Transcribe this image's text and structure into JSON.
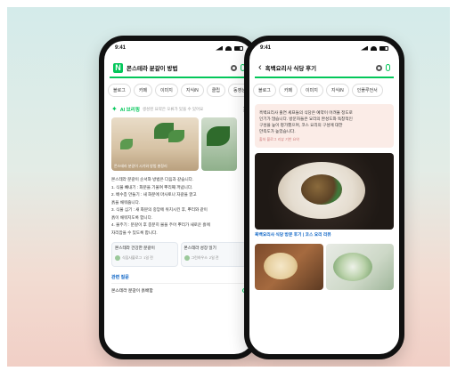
{
  "colors": {
    "brand_green": "#03c75a",
    "link_blue": "#0b63c5"
  },
  "phone_left": {
    "status_time": "9:41",
    "brand_logo": "N",
    "search_query": "몬스테라 분갈이 방법",
    "tabs": [
      "블로그",
      "카페",
      "이미지",
      "지식iN",
      "클립",
      "동영상"
    ],
    "ai_title": "AI 브리핑",
    "ai_note": "생성된 요약은 오류가 있을 수 있어요",
    "photo_caption": "몬스테라 분갈이 시기와 방법 총정리",
    "body_lines": [
      "몬스테라 분갈이 순서와 방법은 다음과 같습니다.",
      "1. 식물 빼내기 : 화분을 기울여 뿌리째 꺼냅니다.",
      "2. 배수층 만들기 : 새 화분에 마사토나 자갈을 깔고",
      "   흙을 채워줍니다.",
      "3. 식물 심기 : 새 화분의 중앙에 위치시킨 후, 뿌리와 같이",
      "   흙이 채워지도록 합니다.",
      "4. 물주기 : 분갈이 후 충분히 물을 주어 뿌리가 새로운 흙에",
      "   자리잡을 수 있도록 합니다."
    ],
    "cards": [
      {
        "title": "몬스테라 건강한 분갈이",
        "author": "식집사블로그",
        "date": "1일 전"
      },
      {
        "title": "몬스테라 성장 일기",
        "author": "그린하우스",
        "date": "2일 전"
      }
    ],
    "related_title": "관련 질문",
    "related_item": "몬스테라 분갈이 흙배합"
  },
  "phone_right": {
    "status_time": "9:41",
    "search_query": "흑백요리사 식당 후기",
    "tabs": [
      "블로그",
      "카페",
      "이미지",
      "지식iN",
      "인플루언서"
    ],
    "summary_lines": [
      "흑백요리사 출연 셰프들의 식당은 예약이 어려울 정도로",
      "인기가 많습니다. 방문자들은 요리의 완성도와 독창적인",
      "구성을 높이 평가했으며, 코스 요리의 구성에 대한",
      "만족도가 높았습니다."
    ],
    "summary_ref": "출처 블로그 리뷰 기반 요약",
    "dish_caption": "흑백요리사 식당 방문 후기 | 코스 요리 리뷰"
  }
}
